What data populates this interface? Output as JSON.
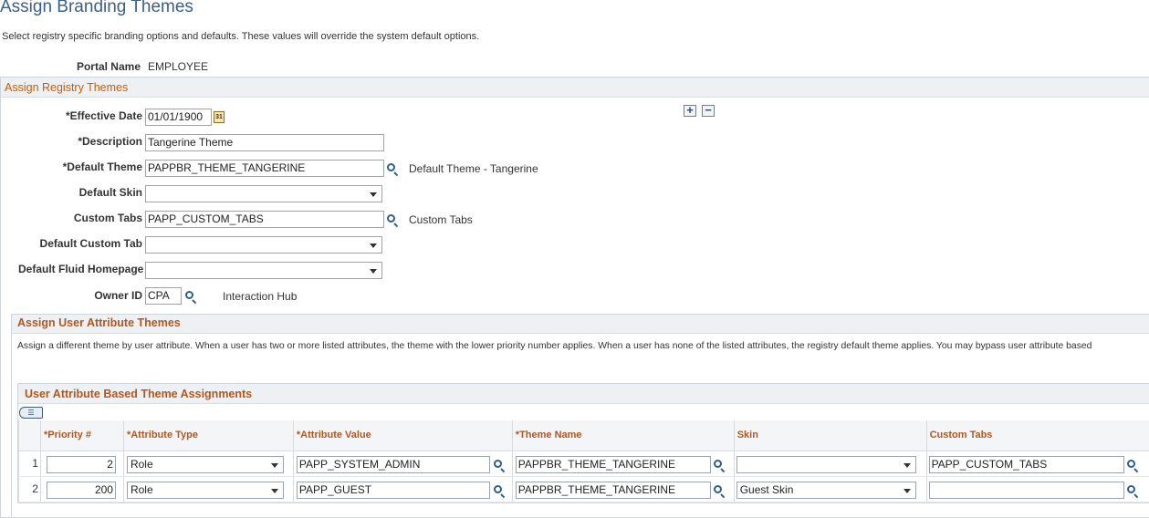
{
  "page": {
    "title": "Assign Branding Themes",
    "instructions": "Select registry specific branding options and defaults. These values will override the system default options."
  },
  "portal": {
    "label": "Portal Name",
    "value": "EMPLOYEE"
  },
  "registry_section": {
    "title": "Assign Registry Themes",
    "effective_date": {
      "label": "*Effective Date",
      "value": "01/01/1900"
    },
    "description": {
      "label": "*Description",
      "value": "Tangerine Theme"
    },
    "default_theme": {
      "label": "*Default Theme",
      "value": "PAPPBR_THEME_TANGERINE",
      "desc": "Default Theme - Tangerine"
    },
    "default_skin": {
      "label": "Default Skin",
      "value": ""
    },
    "custom_tabs": {
      "label": "Custom Tabs",
      "value": "PAPP_CUSTOM_TABS",
      "desc": "Custom Tabs"
    },
    "default_custom_tab": {
      "label": "Default Custom Tab",
      "value": ""
    },
    "default_fluid_homepage": {
      "label": "Default Fluid Homepage",
      "value": ""
    },
    "owner_id": {
      "label": "Owner ID",
      "value": "CPA",
      "desc": "Interaction Hub"
    },
    "add_row_symbol": "+",
    "delete_row_symbol": "−"
  },
  "user_attr_section": {
    "title": "Assign User Attribute Themes",
    "description": "Assign a different theme by user attribute. When a user has two or more listed attributes, the theme with the lower priority number applies. When a user has none of the listed attributes, the registry default theme applies. You may bypass user attribute based",
    "grid": {
      "title": "User Attribute Based Theme Assignments",
      "columns": [
        "*Priority #",
        "*Attribute Type",
        "*Attribute Value",
        "*Theme Name",
        "Skin",
        "Custom Tabs"
      ],
      "rows": [
        {
          "num": "1",
          "priority": "2",
          "attribute_type": "Role",
          "attribute_value": "PAPP_SYSTEM_ADMIN",
          "theme_name": "PAPPBR_THEME_TANGERINE",
          "skin": "",
          "custom_tabs": "PAPP_CUSTOM_TABS"
        },
        {
          "num": "2",
          "priority": "200",
          "attribute_type": "Role",
          "attribute_value": "PAPP_GUEST",
          "theme_name": "PAPPBR_THEME_TANGERINE",
          "skin": "Guest Skin",
          "custom_tabs": ""
        }
      ]
    }
  },
  "icons": {
    "lookup": "search-icon",
    "calendar": "calendar-icon",
    "dropdown": "chevron-down-icon",
    "grid_personalize": "grid-personalize-icon"
  },
  "colors": {
    "title": "#3a5f8c",
    "section_title": "#d15a00",
    "grid_header": "#b6561b"
  }
}
